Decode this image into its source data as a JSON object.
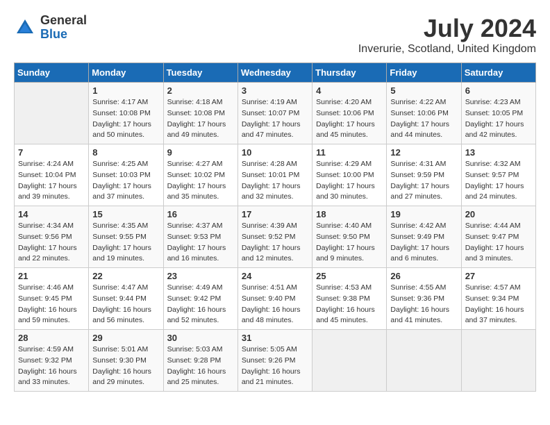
{
  "header": {
    "logo_line1": "General",
    "logo_line2": "Blue",
    "title": "July 2024",
    "subtitle": "Inverurie, Scotland, United Kingdom"
  },
  "calendar": {
    "days_of_week": [
      "Sunday",
      "Monday",
      "Tuesday",
      "Wednesday",
      "Thursday",
      "Friday",
      "Saturday"
    ],
    "weeks": [
      [
        {
          "day": "",
          "info": ""
        },
        {
          "day": "1",
          "info": "Sunrise: 4:17 AM\nSunset: 10:08 PM\nDaylight: 17 hours\nand 50 minutes."
        },
        {
          "day": "2",
          "info": "Sunrise: 4:18 AM\nSunset: 10:08 PM\nDaylight: 17 hours\nand 49 minutes."
        },
        {
          "day": "3",
          "info": "Sunrise: 4:19 AM\nSunset: 10:07 PM\nDaylight: 17 hours\nand 47 minutes."
        },
        {
          "day": "4",
          "info": "Sunrise: 4:20 AM\nSunset: 10:06 PM\nDaylight: 17 hours\nand 45 minutes."
        },
        {
          "day": "5",
          "info": "Sunrise: 4:22 AM\nSunset: 10:06 PM\nDaylight: 17 hours\nand 44 minutes."
        },
        {
          "day": "6",
          "info": "Sunrise: 4:23 AM\nSunset: 10:05 PM\nDaylight: 17 hours\nand 42 minutes."
        }
      ],
      [
        {
          "day": "7",
          "info": "Sunrise: 4:24 AM\nSunset: 10:04 PM\nDaylight: 17 hours\nand 39 minutes."
        },
        {
          "day": "8",
          "info": "Sunrise: 4:25 AM\nSunset: 10:03 PM\nDaylight: 17 hours\nand 37 minutes."
        },
        {
          "day": "9",
          "info": "Sunrise: 4:27 AM\nSunset: 10:02 PM\nDaylight: 17 hours\nand 35 minutes."
        },
        {
          "day": "10",
          "info": "Sunrise: 4:28 AM\nSunset: 10:01 PM\nDaylight: 17 hours\nand 32 minutes."
        },
        {
          "day": "11",
          "info": "Sunrise: 4:29 AM\nSunset: 10:00 PM\nDaylight: 17 hours\nand 30 minutes."
        },
        {
          "day": "12",
          "info": "Sunrise: 4:31 AM\nSunset: 9:59 PM\nDaylight: 17 hours\nand 27 minutes."
        },
        {
          "day": "13",
          "info": "Sunrise: 4:32 AM\nSunset: 9:57 PM\nDaylight: 17 hours\nand 24 minutes."
        }
      ],
      [
        {
          "day": "14",
          "info": "Sunrise: 4:34 AM\nSunset: 9:56 PM\nDaylight: 17 hours\nand 22 minutes."
        },
        {
          "day": "15",
          "info": "Sunrise: 4:35 AM\nSunset: 9:55 PM\nDaylight: 17 hours\nand 19 minutes."
        },
        {
          "day": "16",
          "info": "Sunrise: 4:37 AM\nSunset: 9:53 PM\nDaylight: 17 hours\nand 16 minutes."
        },
        {
          "day": "17",
          "info": "Sunrise: 4:39 AM\nSunset: 9:52 PM\nDaylight: 17 hours\nand 12 minutes."
        },
        {
          "day": "18",
          "info": "Sunrise: 4:40 AM\nSunset: 9:50 PM\nDaylight: 17 hours\nand 9 minutes."
        },
        {
          "day": "19",
          "info": "Sunrise: 4:42 AM\nSunset: 9:49 PM\nDaylight: 17 hours\nand 6 minutes."
        },
        {
          "day": "20",
          "info": "Sunrise: 4:44 AM\nSunset: 9:47 PM\nDaylight: 17 hours\nand 3 minutes."
        }
      ],
      [
        {
          "day": "21",
          "info": "Sunrise: 4:46 AM\nSunset: 9:45 PM\nDaylight: 16 hours\nand 59 minutes."
        },
        {
          "day": "22",
          "info": "Sunrise: 4:47 AM\nSunset: 9:44 PM\nDaylight: 16 hours\nand 56 minutes."
        },
        {
          "day": "23",
          "info": "Sunrise: 4:49 AM\nSunset: 9:42 PM\nDaylight: 16 hours\nand 52 minutes."
        },
        {
          "day": "24",
          "info": "Sunrise: 4:51 AM\nSunset: 9:40 PM\nDaylight: 16 hours\nand 48 minutes."
        },
        {
          "day": "25",
          "info": "Sunrise: 4:53 AM\nSunset: 9:38 PM\nDaylight: 16 hours\nand 45 minutes."
        },
        {
          "day": "26",
          "info": "Sunrise: 4:55 AM\nSunset: 9:36 PM\nDaylight: 16 hours\nand 41 minutes."
        },
        {
          "day": "27",
          "info": "Sunrise: 4:57 AM\nSunset: 9:34 PM\nDaylight: 16 hours\nand 37 minutes."
        }
      ],
      [
        {
          "day": "28",
          "info": "Sunrise: 4:59 AM\nSunset: 9:32 PM\nDaylight: 16 hours\nand 33 minutes."
        },
        {
          "day": "29",
          "info": "Sunrise: 5:01 AM\nSunset: 9:30 PM\nDaylight: 16 hours\nand 29 minutes."
        },
        {
          "day": "30",
          "info": "Sunrise: 5:03 AM\nSunset: 9:28 PM\nDaylight: 16 hours\nand 25 minutes."
        },
        {
          "day": "31",
          "info": "Sunrise: 5:05 AM\nSunset: 9:26 PM\nDaylight: 16 hours\nand 21 minutes."
        },
        {
          "day": "",
          "info": ""
        },
        {
          "day": "",
          "info": ""
        },
        {
          "day": "",
          "info": ""
        }
      ]
    ]
  }
}
